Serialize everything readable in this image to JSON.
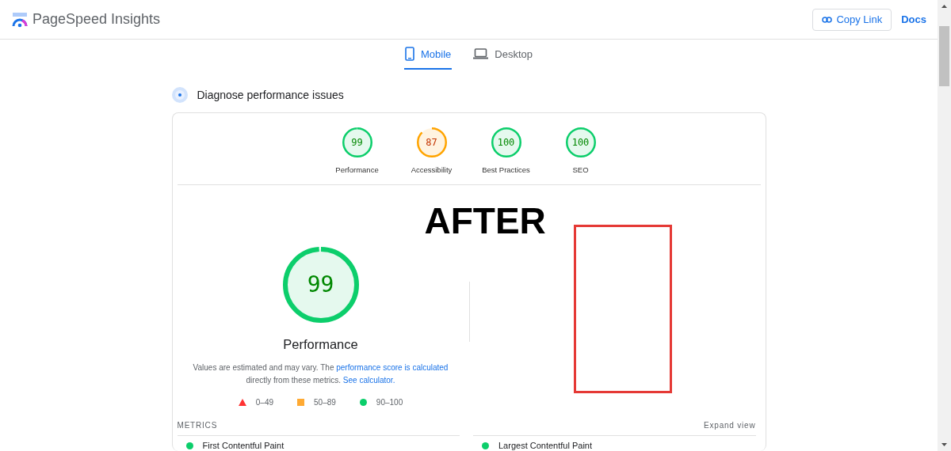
{
  "header": {
    "title": "PageSpeed Insights",
    "buttons": [
      {
        "label": "Copy Link",
        "kind": "outlined"
      },
      {
        "label": "Docs",
        "kind": "text"
      }
    ]
  },
  "tabs": [
    {
      "label": "Mobile",
      "kind": "phone",
      "selected": true
    },
    {
      "label": "Desktop",
      "kind": "laptop",
      "selected": false
    }
  ],
  "section_title": "Diagnose performance issues",
  "scores": [
    {
      "score": "99",
      "label": "Performance",
      "kind": "pass"
    },
    {
      "score": "87",
      "label": "Accessibility",
      "kind": "average"
    },
    {
      "score": "100",
      "label": "Best Practices",
      "kind": "pass"
    },
    {
      "score": "100",
      "label": "SEO",
      "kind": "pass"
    }
  ],
  "main_score": {
    "score": "99",
    "label": "Performance",
    "kind": "pass"
  },
  "description": {
    "text": "Values are estimated and may vary. The ",
    "link1": "performance score is calculated",
    "middle": " directly from these metrics. ",
    "link2": "See calculator."
  },
  "legend": [
    {
      "kind": "triangle",
      "range": "0–49",
      "color": "#ff3333"
    },
    {
      "kind": "square",
      "range": "50–89",
      "color": "#ffaa33"
    },
    {
      "kind": "circle",
      "range": "90–100",
      "color": "#0cce6b"
    }
  ],
  "metrics_title": "METRICS",
  "expand": "Expand view",
  "metrics": [
    {
      "name": "First Contentful Paint",
      "color": "#0cce6b"
    },
    {
      "name": "Largest Contentful Paint",
      "color": "#0cce6b"
    }
  ],
  "annotation": "AFTER"
}
